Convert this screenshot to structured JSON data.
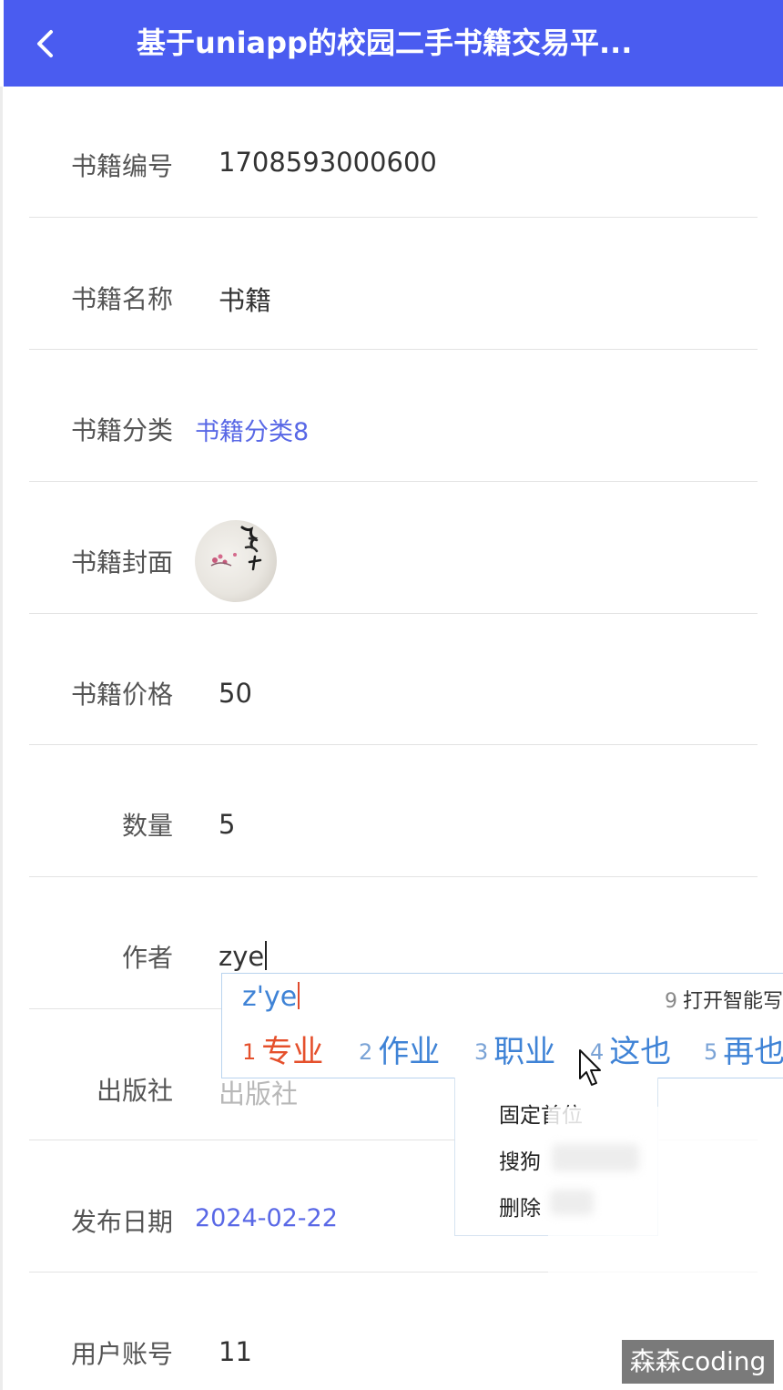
{
  "colors": {
    "header_bg": "#4a5cf0",
    "link": "#5968e6",
    "ime_accent": "#3f83d6",
    "ime_first": "#e5502c"
  },
  "header": {
    "title": "基于uniapp的校园二手书籍交易平...",
    "back_icon": "chevron-left-icon"
  },
  "form": {
    "book_no": {
      "label": "书籍编号",
      "value": "1708593000600"
    },
    "book_name": {
      "label": "书籍名称",
      "value": "书籍"
    },
    "category": {
      "label": "书籍分类",
      "value": "书籍分类8"
    },
    "cover": {
      "label": "书籍封面"
    },
    "price": {
      "label": "书籍价格",
      "value": "50"
    },
    "quantity": {
      "label": "数量",
      "value": "5"
    },
    "author": {
      "label": "作者",
      "value": "zye"
    },
    "publisher": {
      "label": "出版社",
      "placeholder": "出版社"
    },
    "publish_date": {
      "label": "发布日期",
      "value": "2024-02-22"
    },
    "user_account": {
      "label": "用户账号",
      "value": "11"
    }
  },
  "ime": {
    "composition": "z'ye",
    "hint_num": "9",
    "hint_text": "打开智能写",
    "candidates": [
      {
        "num": "1",
        "text": "专业"
      },
      {
        "num": "2",
        "text": "作业"
      },
      {
        "num": "3",
        "text": "职业"
      },
      {
        "num": "4",
        "text": "这也"
      },
      {
        "num": "5",
        "text": "再也"
      }
    ]
  },
  "context_menu": {
    "items": [
      "固定首位",
      "搜狗",
      "删除"
    ]
  },
  "watermark": "森森coding"
}
